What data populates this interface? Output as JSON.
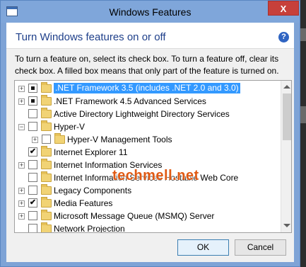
{
  "window": {
    "title": "Windows Features",
    "close_glyph": "X"
  },
  "header": {
    "heading": "Turn Windows features on or off",
    "help_glyph": "?"
  },
  "description": "To turn a feature on, select its check box. To turn a feature off, clear its check box. A filled box means that only part of the feature is turned on.",
  "features": [
    {
      "label": ".NET Framework 3.5 (includes .NET 2.0 and 3.0)",
      "expander": "+",
      "state": "partial",
      "level": 0,
      "selected": true
    },
    {
      "label": ".NET Framework 4.5 Advanced Services",
      "expander": "+",
      "state": "partial",
      "level": 0,
      "selected": false
    },
    {
      "label": "Active Directory Lightweight Directory Services",
      "expander": "",
      "state": "unchecked",
      "level": 0,
      "selected": false
    },
    {
      "label": "Hyper-V",
      "expander": "−",
      "state": "unchecked",
      "level": 0,
      "selected": false
    },
    {
      "label": "Hyper-V Management Tools",
      "expander": "+",
      "state": "unchecked",
      "level": 1,
      "selected": false
    },
    {
      "label": "Internet Explorer 11",
      "expander": "",
      "state": "checked",
      "level": 0,
      "selected": false
    },
    {
      "label": "Internet Information Services",
      "expander": "+",
      "state": "unchecked",
      "level": 0,
      "selected": false
    },
    {
      "label": "Internet Information Services Hostable Web Core",
      "expander": "",
      "state": "unchecked",
      "level": 0,
      "selected": false
    },
    {
      "label": "Legacy Components",
      "expander": "+",
      "state": "unchecked",
      "level": 0,
      "selected": false
    },
    {
      "label": "Media Features",
      "expander": "+",
      "state": "checked",
      "level": 0,
      "selected": false
    },
    {
      "label": "Microsoft Message Queue (MSMQ) Server",
      "expander": "+",
      "state": "unchecked",
      "level": 0,
      "selected": false
    },
    {
      "label": "Network Projection",
      "expander": "",
      "state": "unchecked",
      "level": 0,
      "selected": false
    }
  ],
  "watermark": "techmell.net",
  "buttons": {
    "ok": "OK",
    "cancel": "Cancel"
  },
  "colors": {
    "title_bar": "#7fa6da",
    "close_button": "#c7403a",
    "heading": "#1e3f8a",
    "selection": "#3399ff",
    "watermark": "#e05a14"
  }
}
